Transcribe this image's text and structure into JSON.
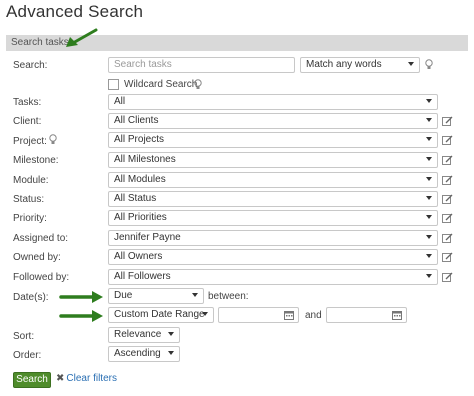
{
  "page": {
    "title": "Advanced Search"
  },
  "section": {
    "label": "Search tasks"
  },
  "search": {
    "label": "Search:",
    "placeholder": "Search tasks",
    "match_mode": "Match any words",
    "wildcard_label": "Wildcard Search"
  },
  "filters": [
    {
      "label": "Tasks:",
      "value": "All"
    },
    {
      "label": "Client:",
      "value": "All Clients"
    },
    {
      "label": "Project:",
      "value": "All Projects"
    },
    {
      "label": "Milestone:",
      "value": "All Milestones"
    },
    {
      "label": "Module:",
      "value": "All Modules"
    },
    {
      "label": "Status:",
      "value": "All Status"
    },
    {
      "label": "Priority:",
      "value": "All Priorities"
    },
    {
      "label": "Assigned to:",
      "value": "Jennifer Payne"
    },
    {
      "label": "Owned by:",
      "value": "All Owners"
    },
    {
      "label": "Followed by:",
      "value": "All Followers"
    }
  ],
  "dates": {
    "label": "Date(s):",
    "type_value": "Due",
    "between_label": "between:",
    "range_value": "Custom Date Range",
    "from_value": "",
    "and_label": "and",
    "to_value": ""
  },
  "sort": {
    "label": "Sort:",
    "value": "Relevance"
  },
  "order": {
    "label": "Order:",
    "value": "Ascending"
  },
  "actions": {
    "search_label": "Search",
    "clear_label": "Clear filters"
  },
  "colors": {
    "accent_green": "#4f8c2b",
    "arrow_green": "#2e7d1e",
    "link_blue": "#2a6fb3",
    "section_gray": "#d9d9d9"
  },
  "icons": [
    "lightbulb-icon",
    "edit-icon",
    "calendar-icon",
    "close-icon",
    "annotation-arrow-icon"
  ]
}
